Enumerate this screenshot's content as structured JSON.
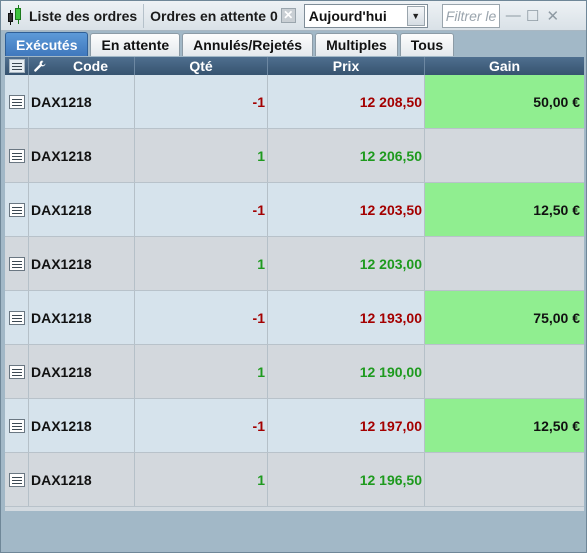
{
  "toolbar": {
    "title": "Liste des ordres",
    "pending": "Ordres en attente 0",
    "period": "Aujourd'hui",
    "filter_placeholder": "Filtrer le",
    "close_glyph": "✕",
    "minimize_glyph": "—",
    "maximize_glyph": "☐"
  },
  "tabs": [
    {
      "label": "Exécutés",
      "active": true
    },
    {
      "label": "En attente",
      "active": false
    },
    {
      "label": "Annulés/Rejetés",
      "active": false
    },
    {
      "label": "Multiples",
      "active": false
    },
    {
      "label": "Tous",
      "active": false
    }
  ],
  "columns": {
    "code": "Code",
    "qty": "Qté",
    "prix": "Prix",
    "gain": "Gain"
  },
  "rows": [
    {
      "code": "DAX1218",
      "qty": "-1",
      "prix": "12 208,50",
      "gain": "50,00 €"
    },
    {
      "code": "DAX1218",
      "qty": "1",
      "prix": "12 206,50",
      "gain": ""
    },
    {
      "code": "DAX1218",
      "qty": "-1",
      "prix": "12 203,50",
      "gain": "12,50 €"
    },
    {
      "code": "DAX1218",
      "qty": "1",
      "prix": "12 203,00",
      "gain": ""
    },
    {
      "code": "DAX1218",
      "qty": "-1",
      "prix": "12 193,00",
      "gain": "75,00 €"
    },
    {
      "code": "DAX1218",
      "qty": "1",
      "prix": "12 190,00",
      "gain": ""
    },
    {
      "code": "DAX1218",
      "qty": "-1",
      "prix": "12 197,00",
      "gain": "12,50 €"
    },
    {
      "code": "DAX1218",
      "qty": "1",
      "prix": "12 196,50",
      "gain": ""
    }
  ],
  "colors": {
    "sell": "#a40000",
    "buy": "#1e9a1e",
    "gain_fill": "#90ee90",
    "active_tab": "#3f78bd"
  }
}
